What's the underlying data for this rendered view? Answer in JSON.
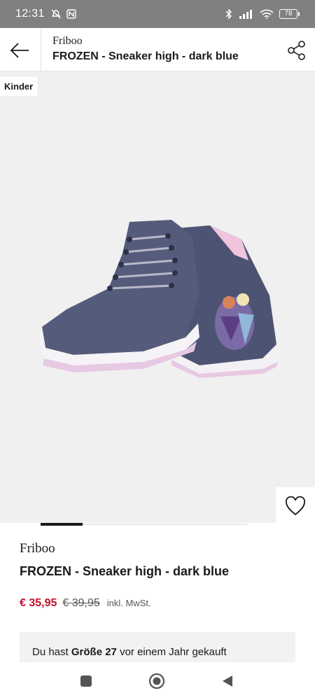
{
  "status_bar": {
    "time": "12:31",
    "battery": "78"
  },
  "header": {
    "brand": "Friboo",
    "title": "FROZEN - Sneaker high - dark blue"
  },
  "image": {
    "badge": "Kinder",
    "carousel_position": 1
  },
  "product": {
    "brand": "Friboo",
    "title": "FROZEN - Sneaker high - dark blue",
    "price_current": "€ 35,95",
    "price_old": "€ 39,95",
    "price_note": "inkl. MwSt."
  },
  "purchase_info": {
    "prefix": "Du hast",
    "size": "Größe 27",
    "suffix": "vor einem Jahr gekauft"
  },
  "colors": {
    "price_red": "#c8102e",
    "image_bg": "#f0f0f0"
  }
}
